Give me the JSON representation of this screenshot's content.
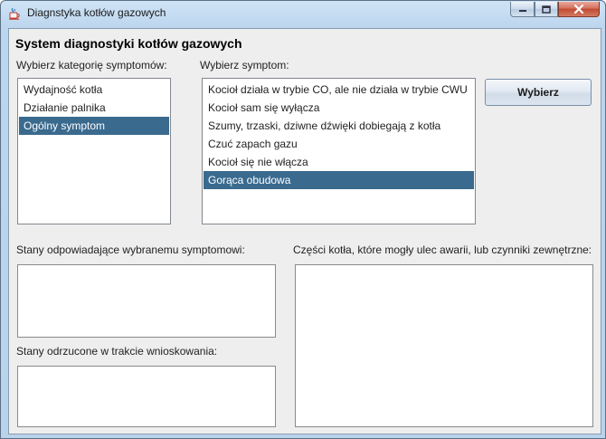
{
  "window": {
    "title": "Diagnstyka kotłów gazowych",
    "icon": "java-cup-icon"
  },
  "heading": "System diagnostyki kotłów gazowych",
  "category": {
    "label": "Wybierz kategorię symptomów:",
    "items": [
      "Wydajność kotła",
      "Działanie palnika",
      "Ogólny symptom"
    ],
    "selected_index": 2
  },
  "symptom": {
    "label": "Wybierz symptom:",
    "items": [
      "Kocioł działa w trybie CO, ale nie działa w trybie CWU",
      "Kocioł sam się wyłącza",
      "Szumy, trzaski, dziwne dźwięki dobiegają z kotła",
      "Czuć zapach gazu",
      "Kocioł się nie włącza",
      "Gorąca obudowa"
    ],
    "selected_index": 5
  },
  "choose_button": "Wybierz",
  "states_matching_label": "Stany odpowiadające wybranemu symptomowi:",
  "states_rejected_label": "Stany odrzucone w trakcie wnioskowania:",
  "parts_label": "Części kotła, które mogły ulec awarii, lub czynniki zewnętrzne:",
  "colors": {
    "selection": "#3a6a8e",
    "panel": "#eeeeee"
  }
}
